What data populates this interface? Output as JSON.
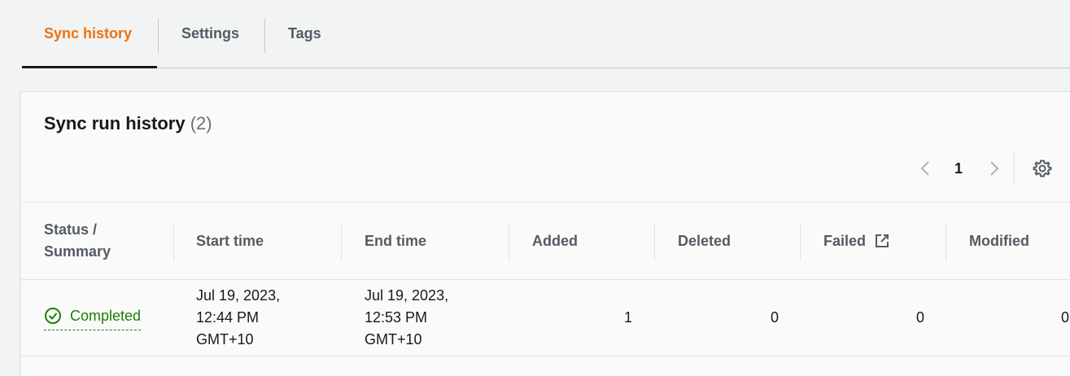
{
  "tabs": [
    {
      "label": "Sync history",
      "active": true
    },
    {
      "label": "Settings",
      "active": false
    },
    {
      "label": "Tags",
      "active": false
    }
  ],
  "panel": {
    "title": "Sync run history",
    "count": "(2)"
  },
  "pagination": {
    "current_page": "1",
    "prev_icon": "chevron-left-icon",
    "next_icon": "chevron-right-icon",
    "settings_icon": "gear-icon"
  },
  "table": {
    "columns": [
      {
        "line1": "Status /",
        "line2": "Summary"
      },
      {
        "line1": "Start time"
      },
      {
        "line1": "End time"
      },
      {
        "line1": "Added"
      },
      {
        "line1": "Deleted"
      },
      {
        "line1": "Failed",
        "icon": "external-link-icon"
      },
      {
        "line1": "Modified"
      }
    ],
    "rows": [
      {
        "status": "Completed",
        "status_icon": "check-circle-icon",
        "start_time": {
          "line1": "Jul 19, 2023,",
          "line2": "12:44 PM",
          "line3": "GMT+10"
        },
        "end_time": {
          "line1": "Jul 19, 2023,",
          "line2": "12:53 PM",
          "line3": "GMT+10"
        },
        "added": "1",
        "deleted": "0",
        "failed": "0",
        "modified": "0"
      }
    ]
  },
  "colors": {
    "accent": "#ec7211",
    "success": "#1d8102",
    "text": "#16191f",
    "muted": "#545b64"
  }
}
